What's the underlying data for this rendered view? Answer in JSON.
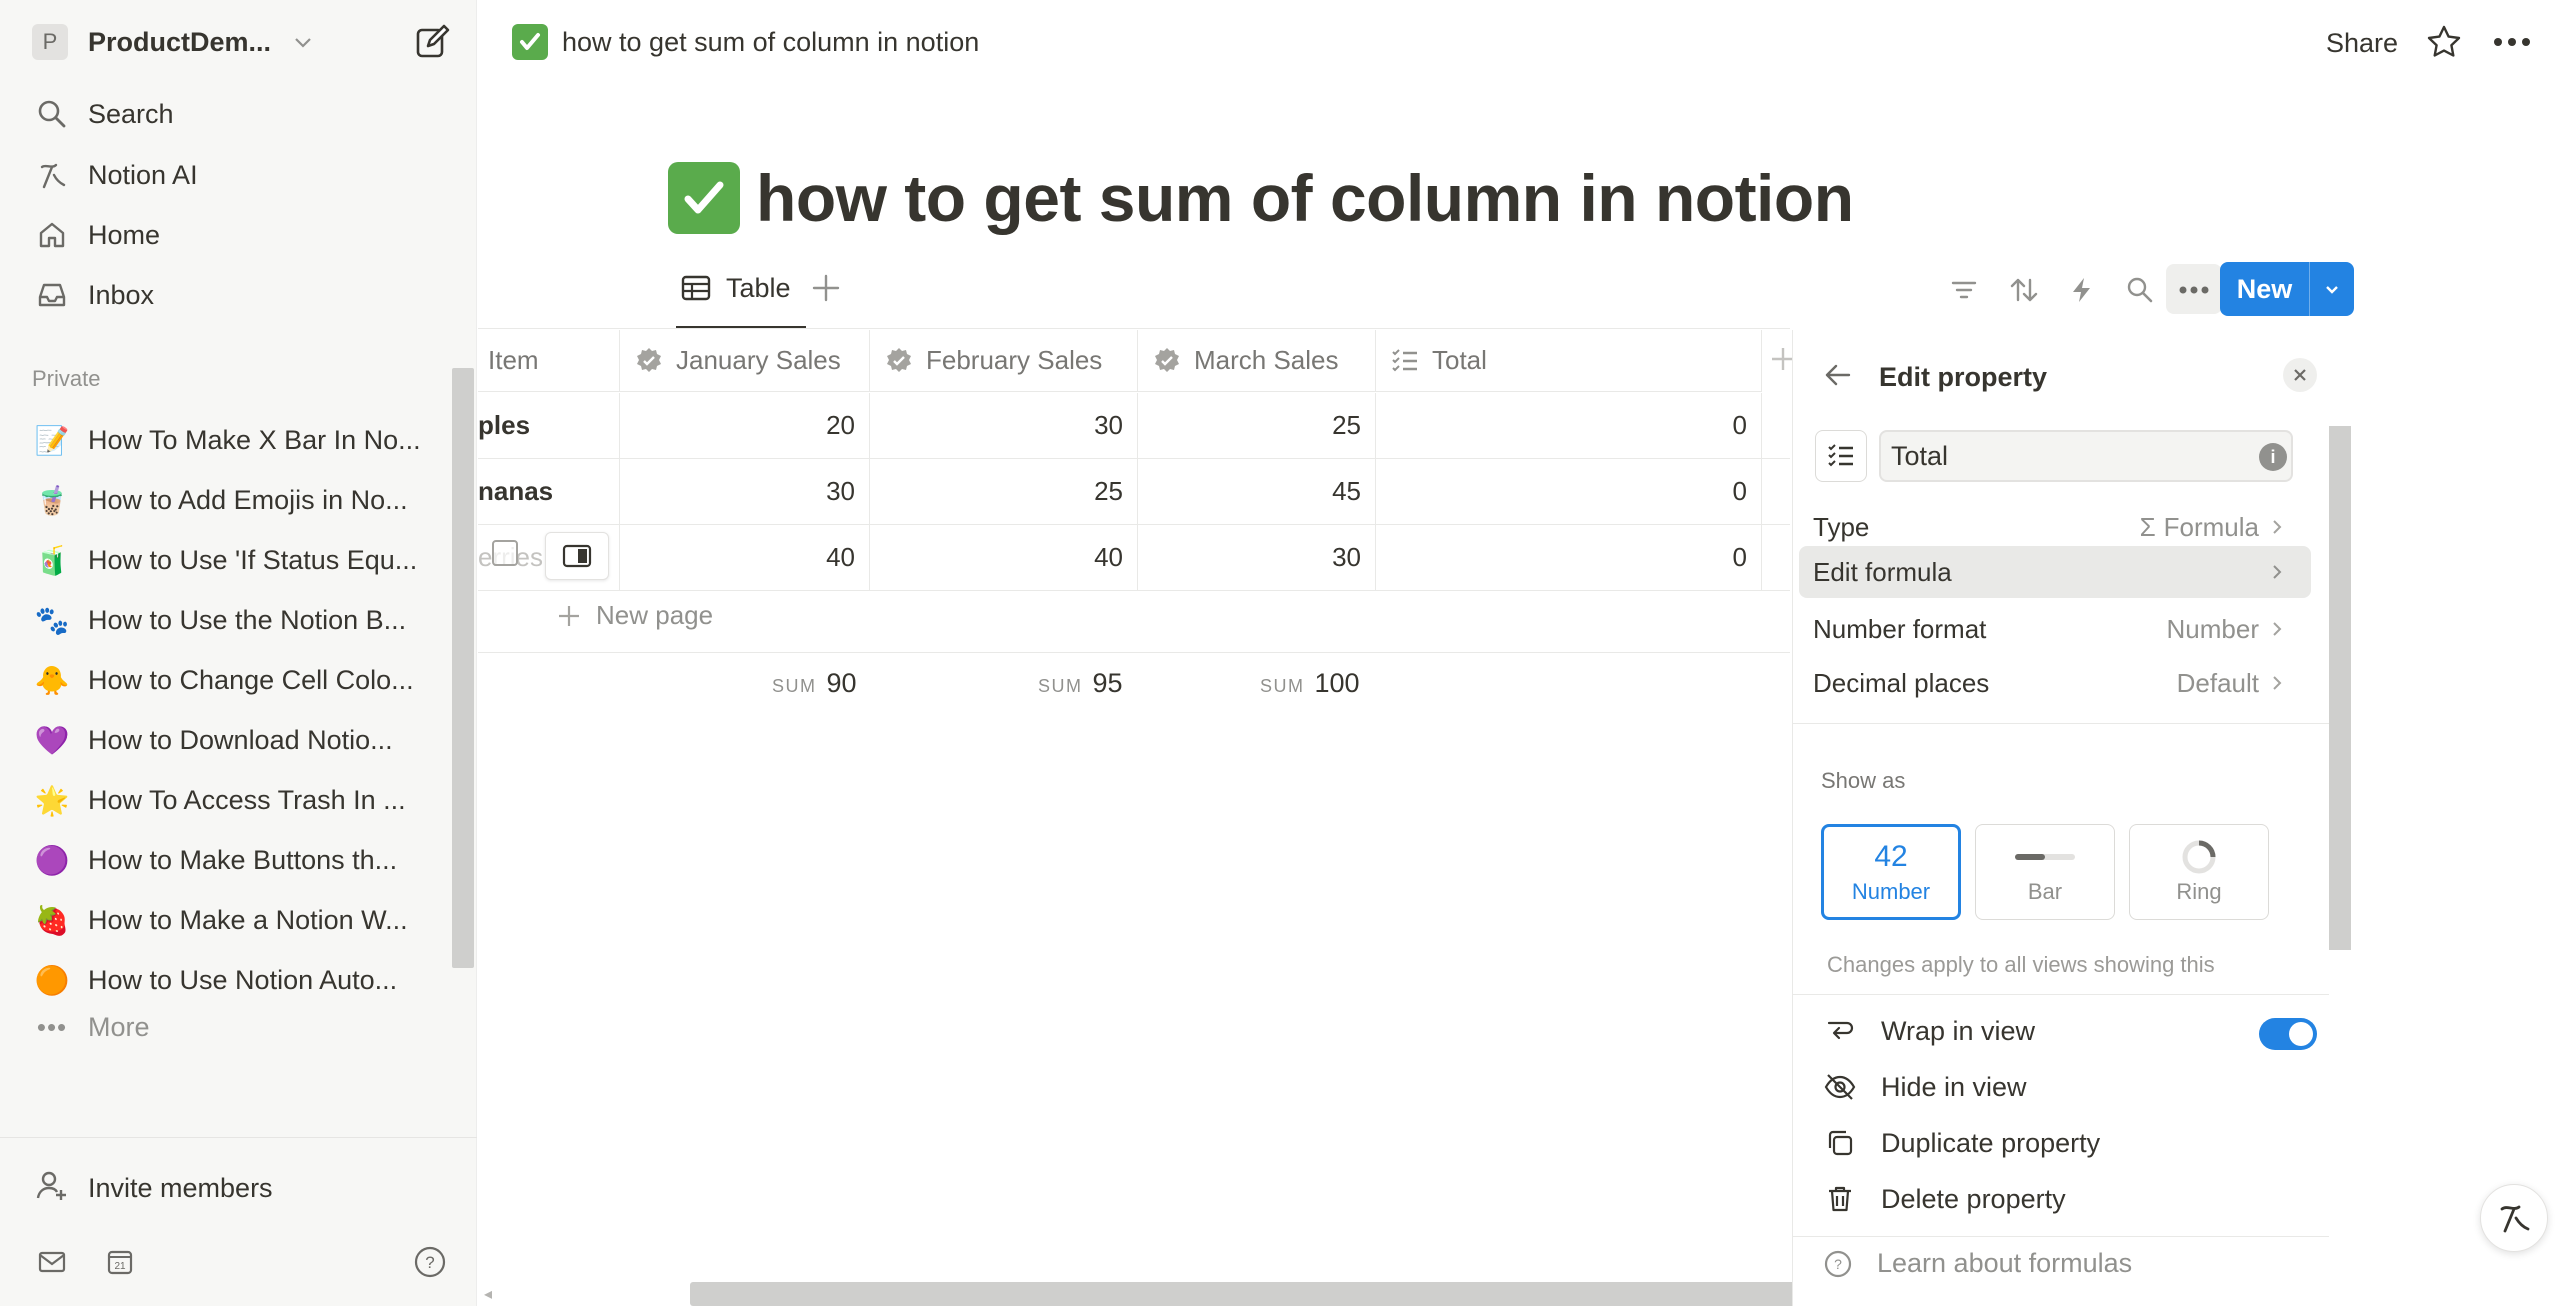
{
  "sidebar": {
    "workspace_initial": "P",
    "workspace_name": "ProductDem...",
    "nav": [
      {
        "label": "Search",
        "icon": "search-icon"
      },
      {
        "label": "Notion AI",
        "icon": "notion-ai-icon"
      },
      {
        "label": "Home",
        "icon": "home-icon"
      },
      {
        "label": "Inbox",
        "icon": "inbox-icon"
      }
    ],
    "section_label": "Private",
    "pages": [
      {
        "emoji": "📝",
        "label": "How To Make X Bar In No..."
      },
      {
        "emoji": "🧋",
        "label": "How to Add Emojis in No..."
      },
      {
        "emoji": "🧃",
        "label": "How to Use 'If Status Equ..."
      },
      {
        "emoji": "🐾",
        "label": "How to Use the Notion B..."
      },
      {
        "emoji": "🐥",
        "label": "How to Change Cell Colo..."
      },
      {
        "emoji": "💜",
        "label": "How to Download Notio..."
      },
      {
        "emoji": "🌟",
        "label": "How To Access Trash In ..."
      },
      {
        "emoji": "🟣",
        "label": "How to Make Buttons th..."
      },
      {
        "emoji": "🍓",
        "label": "How to Make a Notion W..."
      },
      {
        "emoji": "🟠",
        "label": "How to Use Notion Auto..."
      }
    ],
    "more_label": "More",
    "invite_label": "Invite members"
  },
  "topbar": {
    "breadcrumb": "how to get sum of column in notion",
    "share_label": "Share"
  },
  "page": {
    "title": "how to get sum of column in notion"
  },
  "view": {
    "tab_label": "Table",
    "new_label": "New"
  },
  "table": {
    "columns": [
      {
        "label": "Item",
        "icon": "text-icon"
      },
      {
        "label": "January Sales",
        "icon": "formula-check-icon"
      },
      {
        "label": "February Sales",
        "icon": "formula-check-icon"
      },
      {
        "label": "March Sales",
        "icon": "formula-check-icon"
      },
      {
        "label": "Total",
        "icon": "formula-list-icon"
      }
    ],
    "rows": [
      {
        "item": "ples",
        "jan": "20",
        "feb": "30",
        "mar": "25",
        "total": "0"
      },
      {
        "item": "nanas",
        "jan": "30",
        "feb": "25",
        "mar": "45",
        "total": "0"
      },
      {
        "item": "erries",
        "jan": "40",
        "feb": "40",
        "mar": "30",
        "total": "0"
      }
    ],
    "new_page_label": "New page",
    "sums": [
      {
        "key": "SUM",
        "value": "90"
      },
      {
        "key": "SUM",
        "value": "95"
      },
      {
        "key": "SUM",
        "value": "100"
      }
    ]
  },
  "panel": {
    "title": "Edit property",
    "property_name": "Total",
    "type_label": "Type",
    "type_value": "Formula",
    "edit_formula_label": "Edit formula",
    "number_format_label": "Number format",
    "number_format_value": "Number",
    "decimal_label": "Decimal places",
    "decimal_value": "Default",
    "show_as_label": "Show as",
    "show_as": [
      {
        "label": "Number",
        "preview": "42",
        "selected": true
      },
      {
        "label": "Bar",
        "selected": false
      },
      {
        "label": "Ring",
        "selected": false
      }
    ],
    "note": "Changes apply to all views showing this property",
    "wrap_label": "Wrap in view",
    "wrap_on": true,
    "hide_label": "Hide in view",
    "duplicate_label": "Duplicate property",
    "delete_label": "Delete property",
    "learn_label": "Learn about formulas"
  },
  "colors": {
    "accent": "#2383e2",
    "check_green": "#5aab4c",
    "sidebar_bg": "#f7f7f5",
    "text": "#37352f",
    "muted": "#91918e"
  }
}
